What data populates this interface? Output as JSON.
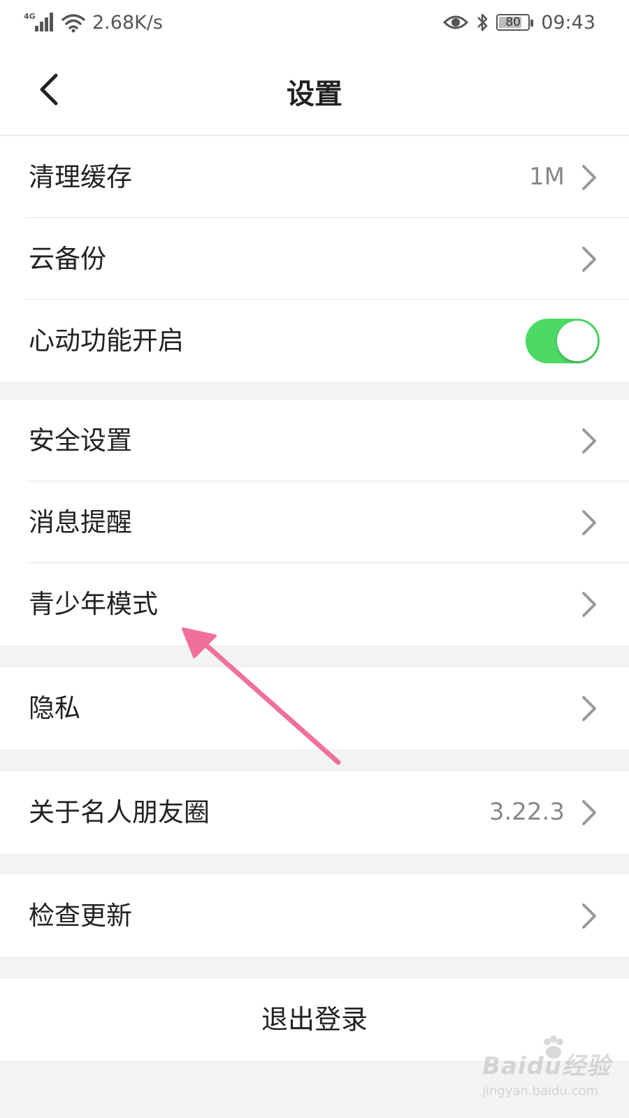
{
  "status_bar": {
    "network_type": "4G",
    "speed": "2.68K/s",
    "battery_level": "80",
    "battery_fraction": 0.8,
    "time": "09:43",
    "icons": [
      "signal-icon",
      "wifi-icon",
      "eye-icon",
      "bluetooth-icon",
      "battery-icon"
    ]
  },
  "header": {
    "title": "设置",
    "back_icon": "chevron-left-icon"
  },
  "groups": [
    {
      "items": [
        {
          "label": "清理缓存",
          "value": "1M",
          "control": "chevron"
        },
        {
          "label": "云备份",
          "value": "",
          "control": "chevron"
        },
        {
          "label": "心动功能开启",
          "value": "",
          "control": "toggle",
          "toggle_on": true
        }
      ]
    },
    {
      "items": [
        {
          "label": "安全设置",
          "value": "",
          "control": "chevron"
        },
        {
          "label": "消息提醒",
          "value": "",
          "control": "chevron"
        },
        {
          "label": "青少年模式",
          "value": "",
          "control": "chevron"
        }
      ]
    },
    {
      "items": [
        {
          "label": "隐私",
          "value": "",
          "control": "chevron"
        }
      ]
    },
    {
      "items": [
        {
          "label": "关于名人朋友圈",
          "value": "3.22.3",
          "control": "chevron"
        }
      ]
    },
    {
      "items": [
        {
          "label": "检查更新",
          "value": "",
          "control": "chevron"
        }
      ]
    }
  ],
  "logout_label": "退出登录",
  "colors": {
    "toggle_on": "#4cd964",
    "annotation_arrow": "#f0709a",
    "background": "#f1f3f5"
  },
  "watermark": {
    "main": "Baidu经验",
    "sub": "jingyan.baidu.com"
  }
}
